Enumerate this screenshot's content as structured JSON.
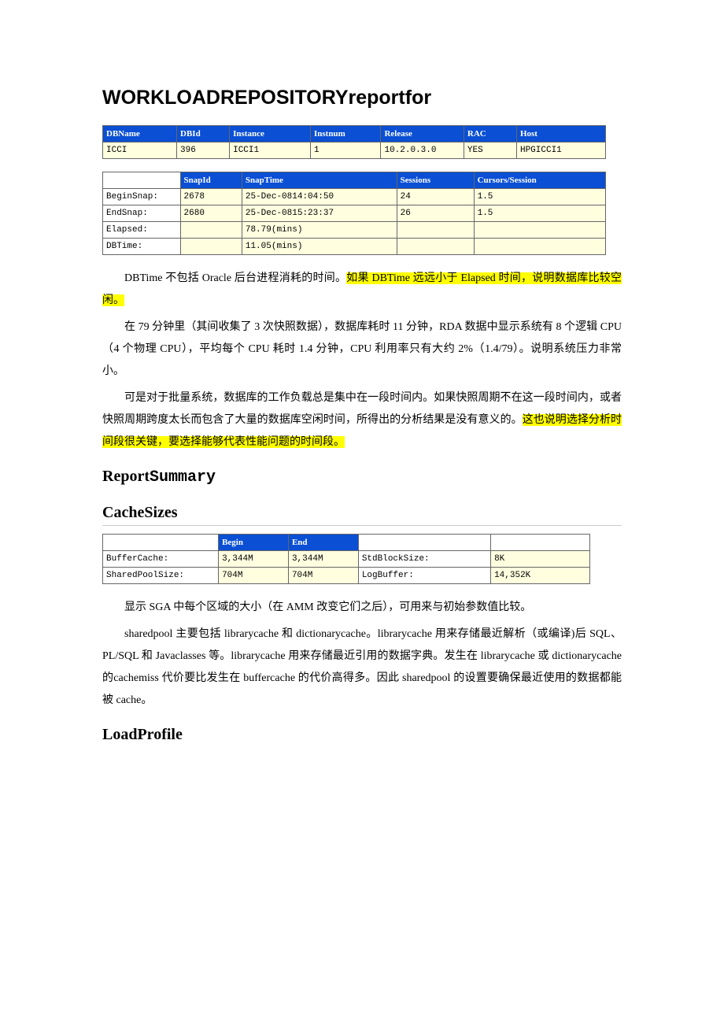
{
  "title": "WORKLOADREPOSITORYreportfor",
  "dbTable": {
    "headers": [
      "DBName",
      "DBId",
      "Instance",
      "Instnum",
      "Release",
      "RAC",
      "Host"
    ],
    "row": [
      "ICCI",
      "396",
      "ICCI1",
      "1",
      "10.2.0.3.0",
      "YES",
      "HPGICCI1"
    ]
  },
  "snapTable": {
    "headers": [
      "",
      "SnapId",
      "SnapTime",
      "Sessions",
      "Cursors/Session"
    ],
    "rows": [
      [
        "BeginSnap:",
        "2678",
        "25-Dec-0814:04:50",
        "24",
        "1.5"
      ],
      [
        "EndSnap:",
        "2680",
        "25-Dec-0815:23:37",
        "26",
        "1.5"
      ],
      [
        "Elapsed:",
        "",
        "78.79(mins)",
        "",
        ""
      ],
      [
        "DBTime:",
        "",
        "11.05(mins)",
        "",
        ""
      ]
    ]
  },
  "para1_a": "DBTime 不包括 Oracle 后台进程消耗的时间。",
  "para1_b": "如果 DBTime 远远小于 Elapsed 时间，说明数据库比较空闲。",
  "para2": "在 79 分钟里（其间收集了 3 次快照数据），数据库耗时 11 分钟，RDA 数据中显示系统有 8 个逻辑 CPU（4 个物理 CPU），平均每个 CPU 耗时 1.4 分钟，CPU 利用率只有大约 2%（1.4/79）。说明系统压力非常小。",
  "para3_a": "可是对于批量系统，数据库的工作负载总是集中在一段时间内。如果快照周期不在这一段时间内，或者快照周期跨度太长而包含了大量的数据库空闲时间，所得出的分析结果是没有意义的。",
  "para3_b": "这也说明选择分析时间段很关键，要选择能够代表性能问题的时间段。",
  "reportSummary_a": "Report",
  "reportSummary_b": "Summary",
  "cacheSizesHeading": "CacheSizes",
  "cacheTable": {
    "headers": [
      "",
      "Begin",
      "End",
      "",
      ""
    ],
    "rows": [
      [
        "BufferCache:",
        "3,344M",
        "3,344M",
        "StdBlockSize:",
        "8K"
      ],
      [
        "SharedPoolSize:",
        "704M",
        "704M",
        "LogBuffer:",
        "14,352K"
      ]
    ]
  },
  "para4": "显示 SGA 中每个区域的大小（在 AMM 改变它们之后），可用来与初始参数值比较。",
  "para5": "sharedpool 主要包括 librarycache 和 dictionarycache。librarycache 用来存储最近解析（或编译)后 SQL、PL/SQL 和 Javaclasses 等。librarycache 用来存储最近引用的数据字典。发生在 librarycache 或 dictionarycache 的cachemiss 代价要比发生在 buffercache 的代价高得多。因此 sharedpool 的设置要确保最近使用的数据都能被 cache。",
  "loadProfileHeading": "LoadProfile"
}
